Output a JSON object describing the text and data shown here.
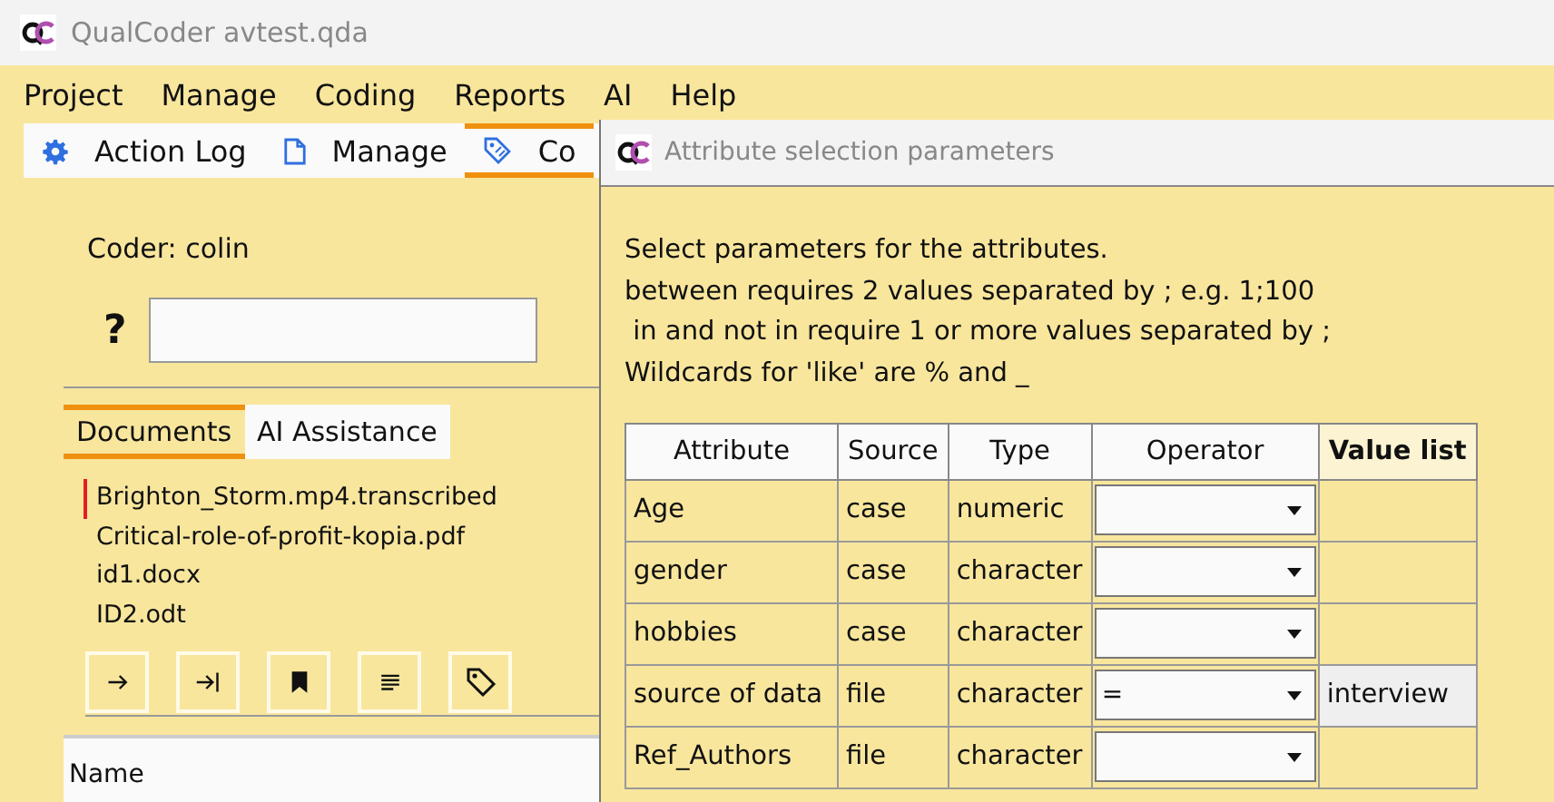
{
  "window": {
    "title": "QualCoder avtest.qda"
  },
  "menu": [
    "Project",
    "Manage",
    "Coding",
    "Reports",
    "AI",
    "Help"
  ],
  "toolbar_tabs": [
    {
      "label": "Action Log",
      "kind": "gear",
      "selected": false
    },
    {
      "label": "Manage",
      "kind": "document",
      "selected": false
    },
    {
      "label": "Co",
      "kind": "tag",
      "selected": true
    }
  ],
  "coder": "Coder: colin",
  "help": "?",
  "panel_tabs": [
    {
      "label": "Documents",
      "selected": true
    },
    {
      "label": "AI Assistance",
      "selected": false
    }
  ],
  "documents": [
    {
      "name": "Brighton_Storm.mp4.transcribed",
      "current": true
    },
    {
      "name": "Critical-role-of-profit-kopia.pdf",
      "current": false
    },
    {
      "name": "id1.docx",
      "current": false
    },
    {
      "name": "ID2.odt",
      "current": false
    }
  ],
  "doc_buttons": [
    {
      "kind": "arrow"
    },
    {
      "kind": "arrow-bar"
    },
    {
      "kind": "bookmark"
    },
    {
      "kind": "lines"
    },
    {
      "kind": "tag"
    }
  ],
  "lower_table": {
    "columns": [
      "Name"
    ]
  },
  "dialog": {
    "title": "Attribute selection parameters",
    "instructions": [
      "Select parameters for the attributes.",
      "between requires 2 values separated by ; e.g. 1;100",
      " in and not in require 1 or more values separated by ;",
      "Wildcards for 'like' are % and _"
    ],
    "columns": [
      {
        "label": "Attribute",
        "selected": false
      },
      {
        "label": "Source",
        "selected": false
      },
      {
        "label": "Type",
        "selected": false
      },
      {
        "label": "Operator",
        "selected": false
      },
      {
        "label": "Value list",
        "selected": true
      }
    ],
    "rows": [
      {
        "attribute": "Age",
        "source": "case",
        "type": "numeric",
        "operator": "",
        "value": ""
      },
      {
        "attribute": "gender",
        "source": "case",
        "type": "character",
        "operator": "",
        "value": ""
      },
      {
        "attribute": "hobbies",
        "source": "case",
        "type": "character",
        "operator": "",
        "value": ""
      },
      {
        "attribute": "source of data",
        "source": "file",
        "type": "character",
        "operator": "=",
        "value": "interview"
      },
      {
        "attribute": "Ref_Authors",
        "source": "file",
        "type": "character",
        "operator": "",
        "value": ""
      }
    ]
  }
}
